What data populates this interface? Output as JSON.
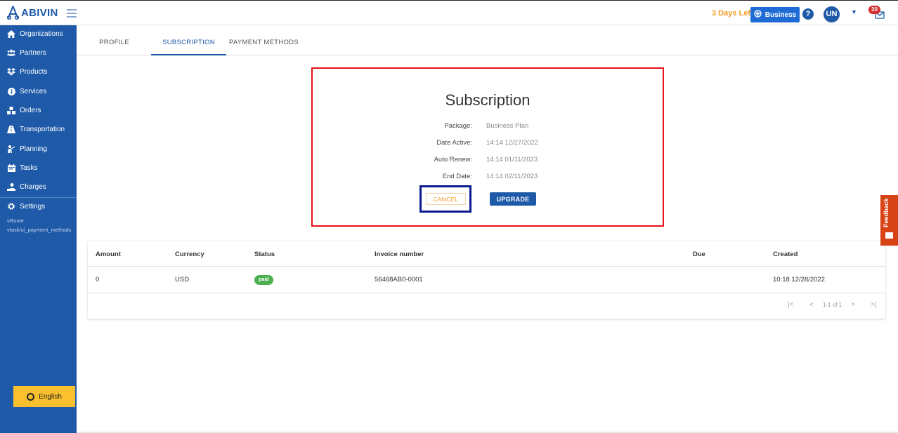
{
  "header": {
    "logo_text": "ABIVIN",
    "days_left": "3 Days Left",
    "business_label": "Business",
    "help_symbol": "?",
    "avatar_initials": "UN",
    "notification_count": "30",
    "icons": [
      "abivin-logo-icon",
      "hamburger-menu-icon",
      "dharma-wheel-icon",
      "help-circle-icon",
      "chevron-down-icon",
      "mail-notification-icon"
    ]
  },
  "sidebar": {
    "items": [
      {
        "label": "Organizations",
        "icon": "home-icon"
      },
      {
        "label": "Partners",
        "icon": "users-icon"
      },
      {
        "label": "Products",
        "icon": "dropbox-icon"
      },
      {
        "label": "Services",
        "icon": "info-icon"
      },
      {
        "label": "Orders",
        "icon": "cubes-icon"
      },
      {
        "label": "Transportation",
        "icon": "road-icon"
      },
      {
        "label": "Planning",
        "icon": "person-chalkboard-icon"
      },
      {
        "label": "Tasks",
        "icon": "calendar-icon"
      },
      {
        "label": "Charges",
        "icon": "hand-holding-icon"
      },
      {
        "label": "Settings",
        "icon": "gear-icon"
      }
    ],
    "meta_line_1": "vRoute",
    "meta_line_2": "vtask/ui_payment_methods",
    "language": "English",
    "accent_color": "#1e5aa8"
  },
  "tabs": [
    {
      "label": "PROFILE",
      "active": false
    },
    {
      "label": "SUBSCRIPTION",
      "active": true
    },
    {
      "label": "PAYMENT METHODS",
      "active": false
    }
  ],
  "subscription": {
    "title": "Subscription",
    "fields": [
      {
        "label": "Package:",
        "value": "Business Plan"
      },
      {
        "label": "Date Active:",
        "value": "14:14 12/27/2022"
      },
      {
        "label": "Auto Renew:",
        "value": "14:14 01/11/2023"
      },
      {
        "label": "End Date:",
        "value": "14:14 02/11/2023"
      }
    ],
    "cancel_label": "CANCEL",
    "upgrade_label": "UPGRADE",
    "highlight_color": "#e8101a",
    "cancel_highlight_color": "#0a1a8f"
  },
  "invoices": {
    "columns": [
      "Amount",
      "Currency",
      "Status",
      "Invoice number",
      "Due",
      "Created"
    ],
    "rows": [
      {
        "amount": "0",
        "currency": "USD",
        "status": "paid",
        "invoice_number": "56468AB0-0001",
        "due": "",
        "created": "10:18 12/28/2022"
      }
    ],
    "pagination": "1-1 of 1",
    "status_color": "#4caf50"
  },
  "feedback_label": "Feedback"
}
